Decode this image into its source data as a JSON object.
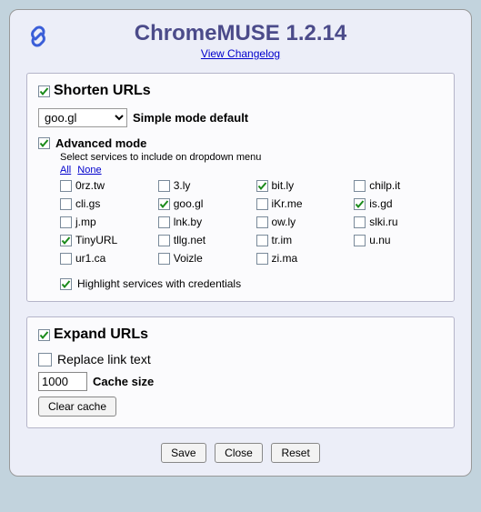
{
  "header": {
    "title": "ChromeMUSE 1.2.14",
    "changelog": "View Changelog"
  },
  "shorten": {
    "title": "Shorten URLs",
    "checked": true,
    "simple_default_label": "Simple mode default",
    "simple_selected": "goo.gl",
    "advanced": {
      "label": "Advanced mode",
      "checked": true,
      "hint": "Select services to include on dropdown menu",
      "all": "All",
      "none": "None",
      "services": [
        {
          "name": "0rz.tw",
          "checked": false
        },
        {
          "name": "3.ly",
          "checked": false
        },
        {
          "name": "bit.ly",
          "checked": true
        },
        {
          "name": "chilp.it",
          "checked": false
        },
        {
          "name": "cli.gs",
          "checked": false
        },
        {
          "name": "goo.gl",
          "checked": true
        },
        {
          "name": "iKr.me",
          "checked": false
        },
        {
          "name": "is.gd",
          "checked": true
        },
        {
          "name": "j.mp",
          "checked": false
        },
        {
          "name": "lnk.by",
          "checked": false
        },
        {
          "name": "ow.ly",
          "checked": false
        },
        {
          "name": "slki.ru",
          "checked": false
        },
        {
          "name": "TinyURL",
          "checked": true
        },
        {
          "name": "tllg.net",
          "checked": false
        },
        {
          "name": "tr.im",
          "checked": false
        },
        {
          "name": "u.nu",
          "checked": false
        },
        {
          "name": "ur1.ca",
          "checked": false
        },
        {
          "name": "Voizle",
          "checked": false
        },
        {
          "name": "zi.ma",
          "checked": false
        }
      ],
      "highlight": {
        "label": "Highlight services with credentials",
        "checked": true
      }
    }
  },
  "expand": {
    "title": "Expand URLs",
    "checked": true,
    "replace": {
      "label": "Replace link text",
      "checked": false
    },
    "cache_value": "1000",
    "cache_label": "Cache size",
    "clear_label": "Clear cache"
  },
  "footer": {
    "save": "Save",
    "close": "Close",
    "reset": "Reset"
  }
}
